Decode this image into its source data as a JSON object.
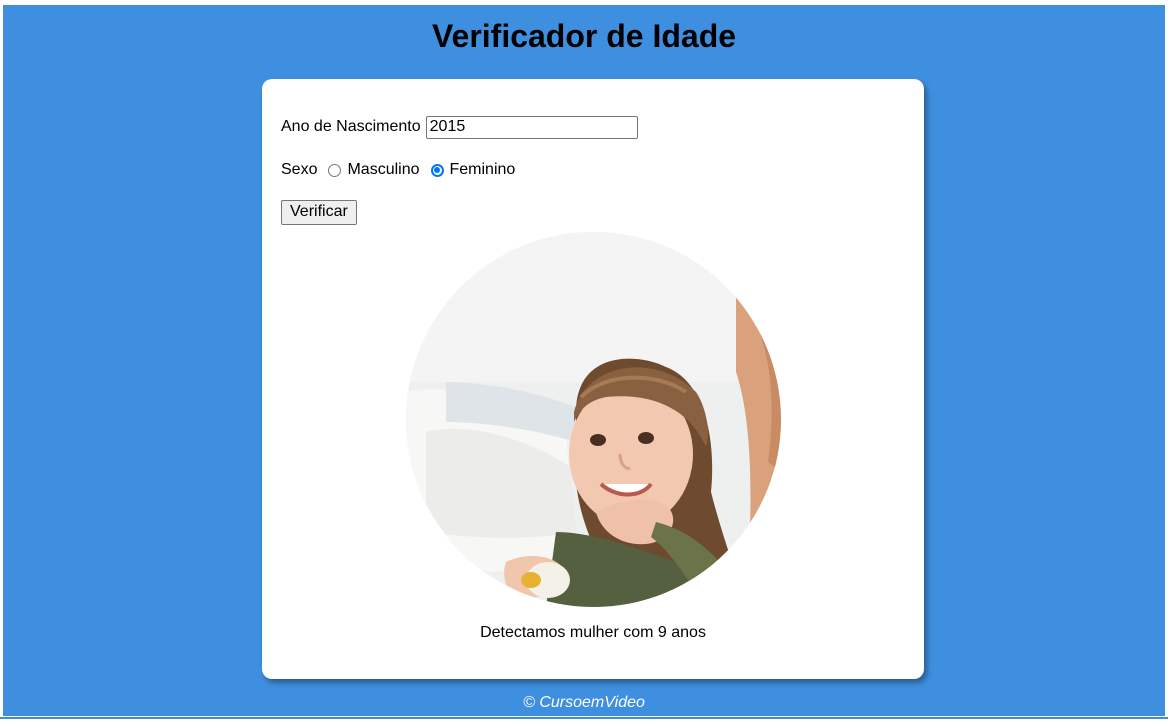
{
  "header": {
    "title": "Verificador de Idade"
  },
  "form": {
    "year_label": "Ano de Nascimento",
    "year_value": "2015",
    "sex_label": "Sexo",
    "options": [
      {
        "label": "Masculino",
        "checked": false
      },
      {
        "label": "Feminino",
        "checked": true
      }
    ],
    "button_label": "Verificar"
  },
  "result": {
    "text": "Detectamos mulher com 9 anos"
  },
  "footer": {
    "text": "© CursoemVideo"
  },
  "colors": {
    "background": "#3f8fe0",
    "card": "#ffffff",
    "radio_accent": "#0075ff",
    "footer_text": "#ffffff"
  }
}
